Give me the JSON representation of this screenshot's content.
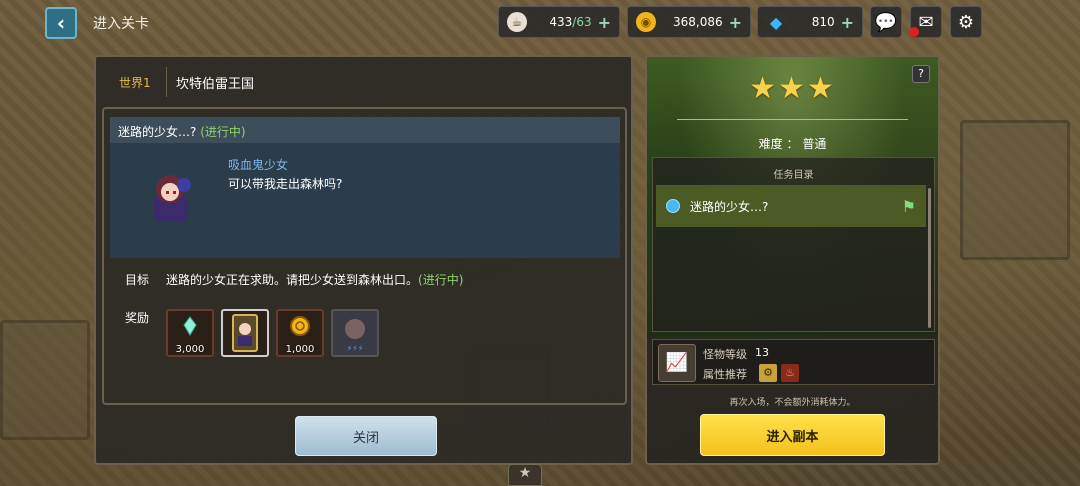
{
  "header": {
    "back_icon": "chevron-left-icon",
    "title": "进入关卡"
  },
  "resources": {
    "stamina": {
      "icon": "coffee-cup-icon",
      "current": "433",
      "max": "/63"
    },
    "gold": {
      "icon": "gold-coin-icon",
      "value": "368,086"
    },
    "gems": {
      "icon": "diamond-icon",
      "value": "810"
    }
  },
  "top_buttons": [
    "chat-icon",
    "mail-icon",
    "gear-icon"
  ],
  "stage": {
    "world_label": "世界1",
    "world_name": "坎特伯雷王国"
  },
  "quest": {
    "title": "迷路的少女…?",
    "status": "(进行中)",
    "npc_name": "吸血鬼少女",
    "npc_line": "可以带我走出森林吗?",
    "goal_label": "目标",
    "goal_text": "迷路的少女正在求助。请把少女送到森林出口。",
    "goal_status": "(进行中)",
    "reward_label": "奖励",
    "rewards": [
      {
        "icon": "crystal-icon",
        "amount": "3,000"
      },
      {
        "icon": "character-card-icon",
        "amount": ""
      },
      {
        "icon": "gold-coin-icon",
        "amount": "1,000"
      },
      {
        "icon": "hero-exp-icon",
        "amount": ""
      }
    ],
    "close_label": "关闭"
  },
  "stage_info": {
    "stars": "★★★",
    "help": "?",
    "difficulty_label": "难度 ：",
    "difficulty_value": "普通",
    "mission_list_title": "任务目录",
    "missions": [
      "迷路的少女…?"
    ],
    "monster_level_label": "怪物等级",
    "monster_level_value": "13",
    "attribute_label": "属性推荐",
    "attributes": [
      "earth-gear-icon",
      "fire-icon"
    ],
    "note": "再次入场，不会额外消耗体力。",
    "enter_label": "进入副本"
  }
}
